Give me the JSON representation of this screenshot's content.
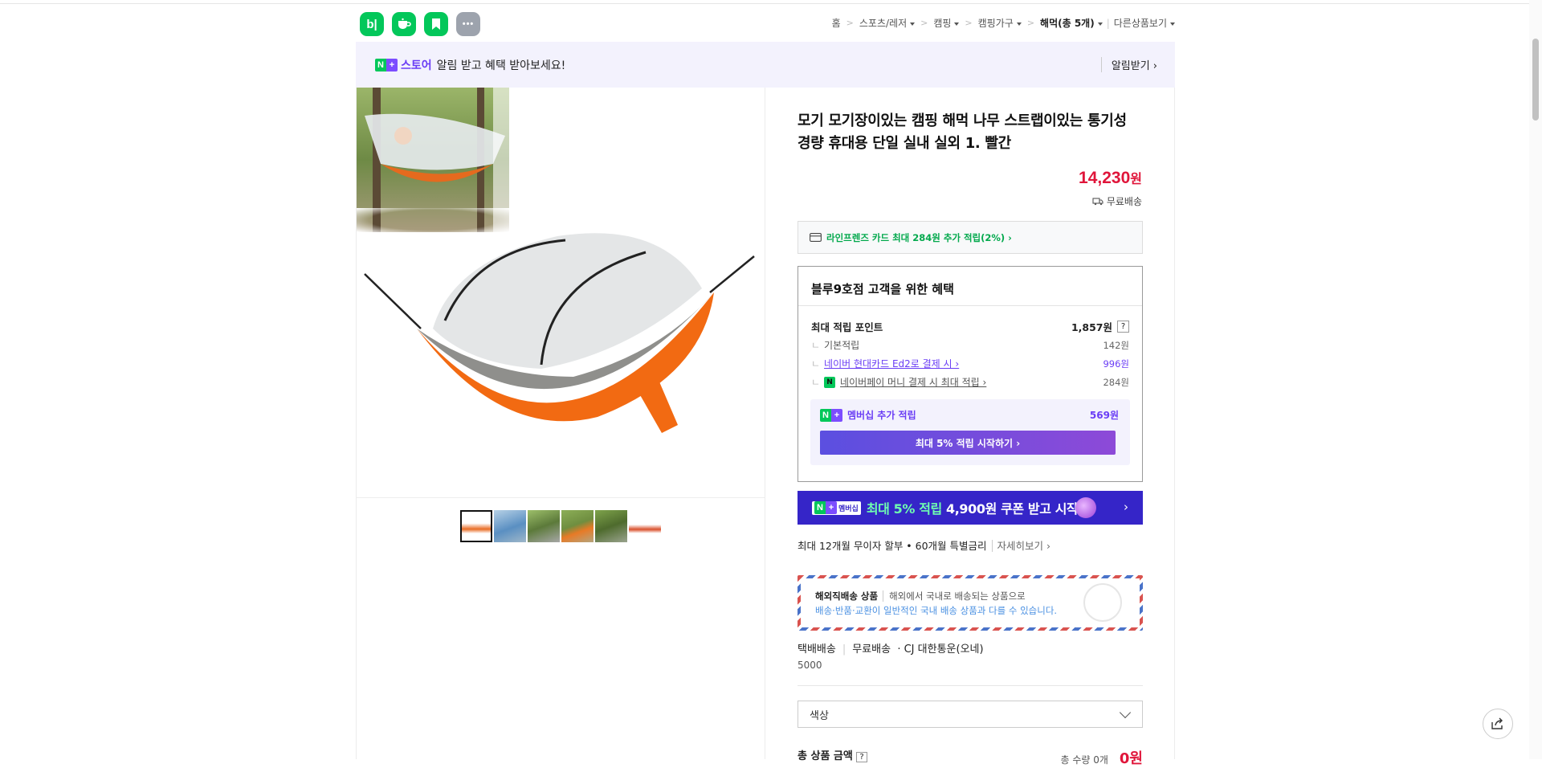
{
  "app_icons": [
    {
      "label": "b|",
      "color": "#03c75a",
      "name": "blog-app"
    },
    {
      "label": "",
      "color": "#03c75a",
      "name": "cafe-app"
    },
    {
      "label": "",
      "color": "#03c75a",
      "name": "bookmark-app"
    },
    {
      "label": "•••",
      "color": "#9da3ad",
      "name": "more-apps"
    }
  ],
  "breadcrumb": {
    "home": "홈",
    "cat1": "스포츠/레저",
    "cat2": "캠핑",
    "cat3": "캠핑가구",
    "current": "해먹(총 5개)",
    "other": "다른상품보기"
  },
  "alarm_bar": {
    "store": "스토어",
    "message": "알림 받고 혜택 받아보세요!",
    "action": "알림받기 ›"
  },
  "product": {
    "title": "모기 모기장이있는 캠핑 해먹 나무 스트랩이있는 통기성 경량 휴대용 단일 실내 실외 1. 빨간",
    "price": "14,230",
    "price_unit": "원",
    "shipping": "무료배송"
  },
  "card_promo": "라인프렌즈 카드 최대 284원 추가 적립(2%) ›",
  "benefit": {
    "heading": "블루9호점 고객을 위한 혜택",
    "max_label": "최대 적립 포인트",
    "max_value": "1,857원",
    "help": "?",
    "rows": [
      {
        "label": "기본적립",
        "value": "142원"
      },
      {
        "label": "네이버 현대카드 Ed2로 결제 시 ›",
        "value": "996원"
      },
      {
        "label": "네이버페이 머니 결제 시 최대 적립 ›",
        "value": "284원"
      }
    ],
    "membership_label": "멤버십 추가 적립",
    "membership_value": "569원",
    "membership_button": "최대 5% 적립 시작하기 ›"
  },
  "banner": {
    "pill": "멤버십",
    "text_highlight": "최대 5% 적립",
    "text_rest": " 4,900원 쿠폰 받고 시작",
    "arrow": "›"
  },
  "installment": {
    "text": "최대 12개월 무이자 할부 • 60개월 특별금리",
    "more": "자세히보기 ›"
  },
  "overseas": {
    "title": "해외직배송 상품",
    "desc": "해외에서 국내로 배송되는 상품으로",
    "notice": "배송·반품·교환이 일반적인 국내 배송 상품과 다를 수 있습니다."
  },
  "delivery": {
    "type": "택배배송",
    "fee": "무료배송",
    "carrier": "· CJ 대한통운(오네)",
    "cost": "5000"
  },
  "option_select": {
    "placeholder": "색상"
  },
  "total": {
    "label": "총 상품 금액",
    "help": "?",
    "qty": "총 수량 0개",
    "amount": "0원"
  },
  "colors": {
    "naver_green": "#03c75a",
    "price_red": "#e0153a",
    "membership_purple": "#6a3df5",
    "banner_blue": "#3525c8"
  }
}
